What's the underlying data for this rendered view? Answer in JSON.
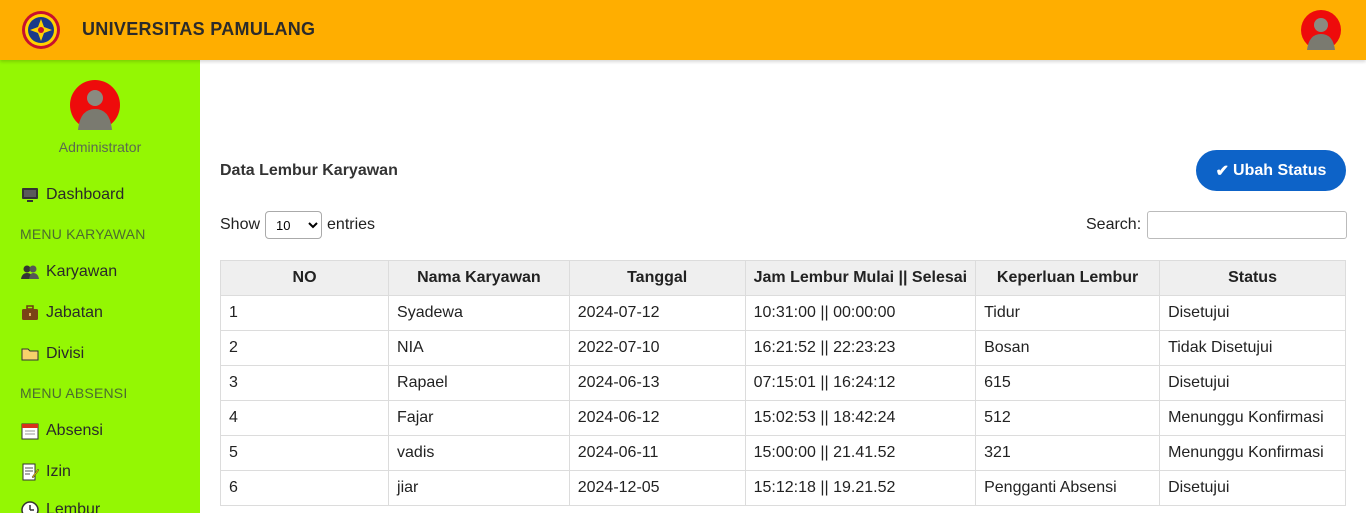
{
  "header": {
    "title": "UNIVERSITAS PAMULANG"
  },
  "sidebar": {
    "role": "Administrator",
    "items": [
      {
        "label": "Dashboard",
        "icon": "monitor-icon"
      },
      {
        "label": "Karyawan",
        "icon": "users-icon"
      },
      {
        "label": "Jabatan",
        "icon": "briefcase-icon"
      },
      {
        "label": "Divisi",
        "icon": "folder-icon"
      },
      {
        "label": "Absensi",
        "icon": "calendar-icon"
      },
      {
        "label": "Izin",
        "icon": "memo-icon"
      },
      {
        "label": "Lembur",
        "icon": "clock-icon"
      }
    ],
    "sections": [
      "MENU KARYAWAN",
      "MENU ABSENSI"
    ]
  },
  "main": {
    "title": "Data Lembur Karyawan",
    "status_button": "Ubah Status",
    "status_button_icon": "✔",
    "show_label": "Show",
    "entries_label": "entries",
    "page_size": "10",
    "search_label": "Search:",
    "search_value": ""
  },
  "table": {
    "headers": [
      "NO",
      "Nama Karyawan",
      "Tanggal",
      "Jam Lembur Mulai || Selesai",
      "Keperluan Lembur",
      "Status"
    ],
    "rows": [
      [
        "1",
        "Syadewa",
        "2024-07-12",
        "10:31:00 || 00:00:00",
        "Tidur",
        "Disetujui"
      ],
      [
        "2",
        "NIA",
        "2022-07-10",
        "16:21:52 || 22:23:23",
        "Bosan",
        "Tidak Disetujui"
      ],
      [
        "3",
        "Rapael",
        "2024-06-13",
        "07:15:01 || 16:24:12",
        "615",
        "Disetujui"
      ],
      [
        "4",
        "Fajar",
        "2024-06-12",
        "15:02:53 || 18:42:24",
        "512",
        "Menunggu Konfirmasi"
      ],
      [
        "5",
        "vadis",
        "2024-06-11",
        "15:00:00 || 21.41.52",
        "321",
        "Menunggu Konfirmasi"
      ],
      [
        "6",
        "jiar",
        "2024-12-05",
        "15:12:18 || 19.21.52",
        "Pengganti Absensi",
        "Disetujui"
      ]
    ]
  },
  "colors": {
    "topbar": "#ffae00",
    "sidebar": "#94f703",
    "button": "#0d63c8"
  }
}
